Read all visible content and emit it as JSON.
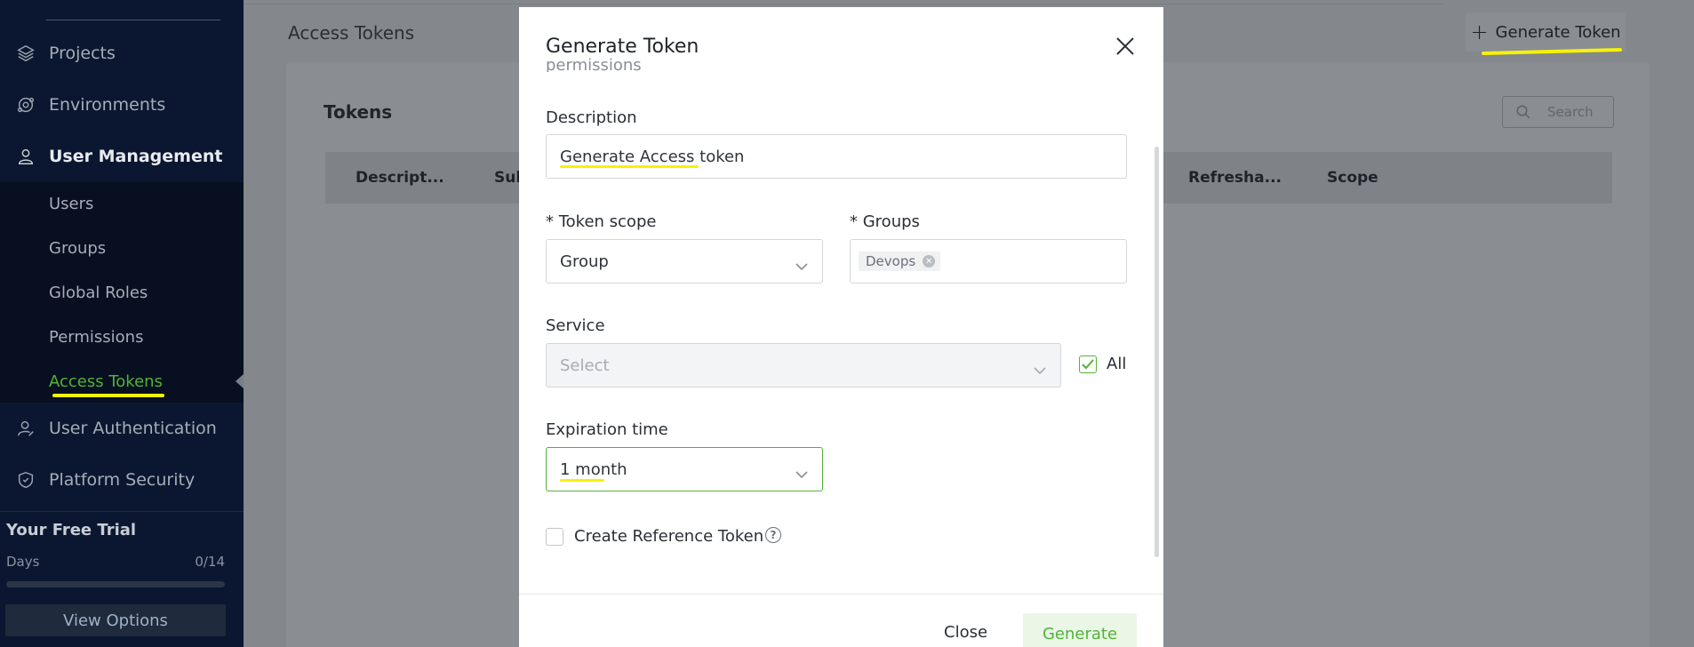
{
  "sidebar": {
    "items": [
      {
        "label": "Projects",
        "icon": "layers-icon"
      },
      {
        "label": "Environments",
        "icon": "environments-icon"
      },
      {
        "label": "User Management",
        "icon": "user-icon"
      },
      {
        "label": "User Authentication",
        "icon": "user-auth-icon"
      },
      {
        "label": "Platform Security",
        "icon": "shield-icon"
      }
    ],
    "submenu": [
      "Users",
      "Groups",
      "Global Roles",
      "Permissions",
      "Access Tokens"
    ],
    "active_submenu": "Access Tokens",
    "trial": {
      "title": "Your Free Trial",
      "days_label": "Days",
      "days_count": "0/14",
      "progress": 0,
      "button": "View Options"
    }
  },
  "main": {
    "page_title": "Access Tokens",
    "generate_button": "Generate Token",
    "tokens_title": "Tokens",
    "search_placeholder": "Search",
    "columns": [
      "Descript...",
      "Sub",
      "Refresha...",
      "Scope"
    ]
  },
  "modal": {
    "title": "Generate Token",
    "partial_text": "permissions",
    "description_label": "Description",
    "description_value": "Generate Access token",
    "token_scope_label": "* Token scope",
    "token_scope_value": "Group",
    "groups_label": "* Groups",
    "groups_tag": "Devops",
    "service_label": "Service",
    "service_placeholder": "Select",
    "all_label": "All",
    "all_checked": true,
    "expiration_label": "Expiration time",
    "expiration_value": "1 month",
    "reference_label": "Create Reference Token",
    "reference_checked": false,
    "help_glyph": "?",
    "close_button": "Close",
    "generate_button": "Generate"
  },
  "colors": {
    "accent_green": "#52b337",
    "sidebar_bg": "#0b1730",
    "annotation_yellow": "#f5f20a"
  }
}
